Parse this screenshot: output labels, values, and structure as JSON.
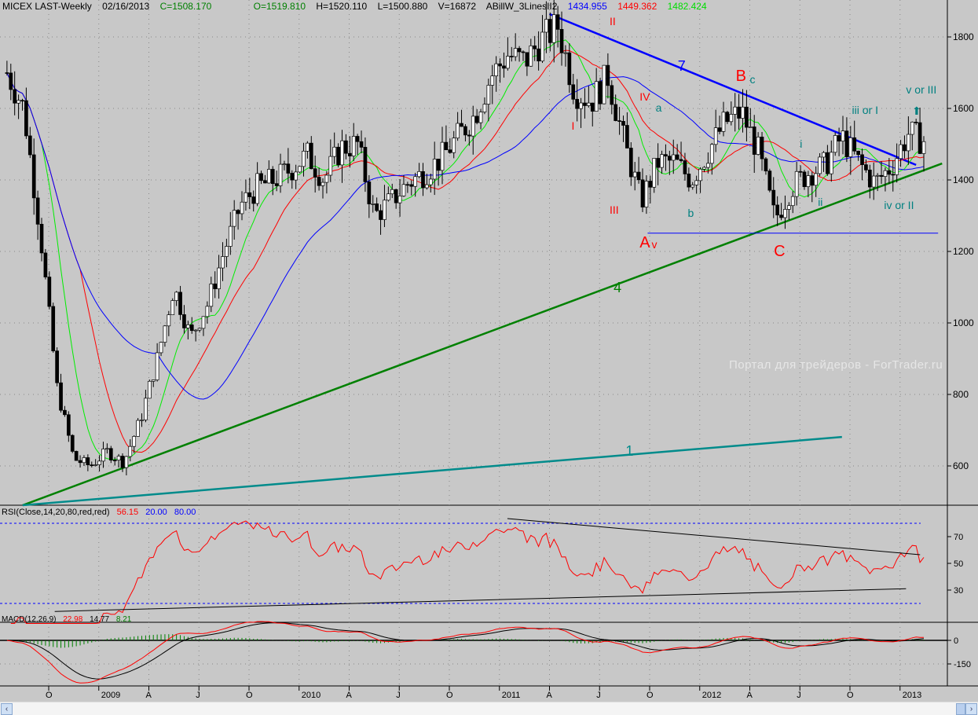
{
  "header": {
    "symbol": "MICEX LAST-Weekly",
    "date": "02/16/2013",
    "close": "C=1508.170",
    "open": "O=1519.810",
    "high": "H=1520.110",
    "low": "L=1500.880",
    "volume": "V=16872",
    "indicator": "ABillW_3LinesII2",
    "ma_blue": "1434.955",
    "ma_red": "1449.362",
    "ma_green": "1482.424"
  },
  "watermark": "Портал для трейдеров - ForTrader.ru",
  "rsi_legend": {
    "label": "RSI(Close,14,20,80,red,red)",
    "value": "56.15",
    "low": "20.00",
    "high": "80.00"
  },
  "macd_legend": {
    "label": "MACD(12,26,9)",
    "macd": "22.98",
    "signal": "14.77",
    "hist": "8.21"
  },
  "colors": {
    "background": "#c8c8c8",
    "ma_green": "#00ff00",
    "ma_red": "#ff0000",
    "ma_blue": "#0000ff",
    "label_red": "#ff0000",
    "label_teal": "#008080",
    "line7": "#0000ff",
    "line4": "#008000",
    "line1": "#008b8b"
  },
  "chart_data": {
    "type": "candlestick",
    "title": "MICEX LAST-Weekly",
    "ylim": [
      480,
      1880
    ],
    "yticks": [
      600,
      800,
      1000,
      1200,
      1400,
      1600,
      1800
    ],
    "xticks": [
      {
        "t": 2008.75,
        "label": "O"
      },
      {
        "t": 2009.0,
        "label": "2009"
      },
      {
        "t": 2009.25,
        "label": "A"
      },
      {
        "t": 2009.5,
        "label": "J"
      },
      {
        "t": 2009.75,
        "label": "O"
      },
      {
        "t": 2010.0,
        "label": "2010"
      },
      {
        "t": 2010.25,
        "label": "A"
      },
      {
        "t": 2010.5,
        "label": "J"
      },
      {
        "t": 2010.75,
        "label": "O"
      },
      {
        "t": 2011.0,
        "label": "2011"
      },
      {
        "t": 2011.25,
        "label": "A"
      },
      {
        "t": 2011.5,
        "label": "J"
      },
      {
        "t": 2011.75,
        "label": "O"
      },
      {
        "t": 2012.0,
        "label": "2012"
      },
      {
        "t": 2012.25,
        "label": "A"
      },
      {
        "t": 2012.5,
        "label": "J"
      },
      {
        "t": 2012.75,
        "label": "O"
      },
      {
        "t": 2013.0,
        "label": "2013"
      }
    ],
    "monthly_closes": [
      [
        "2008-07",
        1700
      ],
      [
        "2008-08",
        1600
      ],
      [
        "2008-09",
        1250
      ],
      [
        "2008-10",
        820
      ],
      [
        "2008-11",
        620
      ],
      [
        "2008-12",
        600
      ],
      [
        "2009-01",
        640
      ],
      [
        "2009-02",
        610
      ],
      [
        "2009-03",
        730
      ],
      [
        "2009-04",
        900
      ],
      [
        "2009-05",
        1100
      ],
      [
        "2009-06",
        960
      ],
      [
        "2009-07",
        1050
      ],
      [
        "2009-08",
        1200
      ],
      [
        "2009-09",
        1330
      ],
      [
        "2009-10",
        1380
      ],
      [
        "2009-11",
        1400
      ],
      [
        "2009-12",
        1430
      ],
      [
        "2010-01",
        1470
      ],
      [
        "2010-02",
        1400
      ],
      [
        "2010-03",
        1490
      ],
      [
        "2010-04",
        1500
      ],
      [
        "2010-05",
        1300
      ],
      [
        "2010-06",
        1340
      ],
      [
        "2010-07",
        1390
      ],
      [
        "2010-08",
        1420
      ],
      [
        "2010-09",
        1460
      ],
      [
        "2010-10",
        1520
      ],
      [
        "2010-11",
        1580
      ],
      [
        "2010-12",
        1690
      ],
      [
        "2011-01",
        1750
      ],
      [
        "2011-02",
        1730
      ],
      [
        "2011-03",
        1790
      ],
      [
        "2011-04",
        1830
      ],
      [
        "2011-05",
        1650
      ],
      [
        "2011-06",
        1620
      ],
      [
        "2011-07",
        1690
      ],
      [
        "2011-08",
        1500
      ],
      [
        "2011-09",
        1340
      ],
      [
        "2011-10",
        1450
      ],
      [
        "2011-11",
        1450
      ],
      [
        "2011-12",
        1400
      ],
      [
        "2012-01",
        1480
      ],
      [
        "2012-02",
        1560
      ],
      [
        "2012-03",
        1590
      ],
      [
        "2012-04",
        1480
      ],
      [
        "2012-05",
        1290
      ],
      [
        "2012-06",
        1380
      ],
      [
        "2012-07",
        1420
      ],
      [
        "2012-08",
        1440
      ],
      [
        "2012-09",
        1520
      ],
      [
        "2012-10",
        1450
      ],
      [
        "2012-11",
        1390
      ],
      [
        "2012-12",
        1440
      ],
      [
        "2013-01",
        1530
      ],
      [
        "2013-02",
        1508
      ]
    ],
    "moving_averages": [
      {
        "name": "green",
        "period": 10
      },
      {
        "name": "red",
        "period": 20
      },
      {
        "name": "blue",
        "period": 40
      }
    ],
    "trendlines": [
      {
        "name": "7",
        "color": "#0000ff",
        "from": [
          2011.25,
          1864
        ],
        "to": [
          2013.08,
          1442
        ],
        "label_at": [
          2011.89,
          1705
        ]
      },
      {
        "name": "4",
        "color": "#008000",
        "from": [
          2008.62,
          490
        ],
        "to": [
          2013.21,
          1446
        ],
        "label_at": [
          2011.57,
          1086
        ]
      },
      {
        "name": "1",
        "color": "#008b8b",
        "from": [
          2008.62,
          490
        ],
        "to": [
          2012.71,
          681
        ],
        "label_at": [
          2011.63,
          629
        ]
      },
      {
        "name": "support",
        "color": "#0000ff",
        "from": [
          2011.74,
          1251
        ],
        "to": [
          2013.19,
          1251
        ]
      }
    ],
    "wave_labels": [
      {
        "text": "II",
        "color": "red",
        "t": 2011.55,
        "price": 1833
      },
      {
        "text": "I",
        "color": "red",
        "t": 2011.36,
        "price": 1541
      },
      {
        "text": "IV",
        "color": "red",
        "t": 2011.7,
        "price": 1622
      },
      {
        "text": "a",
        "color": "teal",
        "t": 2011.78,
        "price": 1591
      },
      {
        "text": "III",
        "color": "red",
        "t": 2011.55,
        "price": 1305
      },
      {
        "text": "b",
        "color": "teal",
        "t": 2011.94,
        "price": 1297
      },
      {
        "text": "A",
        "color": "red",
        "big": true,
        "t": 2011.7,
        "price": 1211
      },
      {
        "text": "v",
        "color": "red",
        "t": 2011.76,
        "price": 1209
      },
      {
        "text": "B",
        "color": "red",
        "big": true,
        "t": 2012.18,
        "price": 1677
      },
      {
        "text": "c",
        "color": "teal",
        "t": 2012.25,
        "price": 1670
      },
      {
        "text": "C",
        "color": "red",
        "big": true,
        "t": 2012.37,
        "price": 1187
      },
      {
        "text": "i",
        "color": "teal",
        "t": 2012.5,
        "price": 1490
      },
      {
        "text": "ii",
        "color": "teal",
        "t": 2012.59,
        "price": 1327
      },
      {
        "text": "iii or I",
        "color": "teal",
        "t": 2012.76,
        "price": 1585
      },
      {
        "text": "iv or II",
        "color": "teal",
        "t": 2012.92,
        "price": 1319
      },
      {
        "text": "v or III",
        "color": "teal",
        "t": 2013.03,
        "price": 1642
      }
    ],
    "rsi": {
      "period": 14,
      "levels": [
        20,
        80
      ],
      "ticks": [
        30,
        50,
        70
      ],
      "trendlines": [
        {
          "from": [
            2011.04,
            83.5
          ],
          "to": [
            2013.1,
            56.5
          ]
        },
        {
          "from": [
            2008.78,
            14
          ],
          "to": [
            2013.03,
            31
          ]
        }
      ]
    },
    "macd": {
      "fast": 12,
      "slow": 26,
      "signal": 9,
      "ticks": [
        0,
        -150
      ]
    }
  }
}
